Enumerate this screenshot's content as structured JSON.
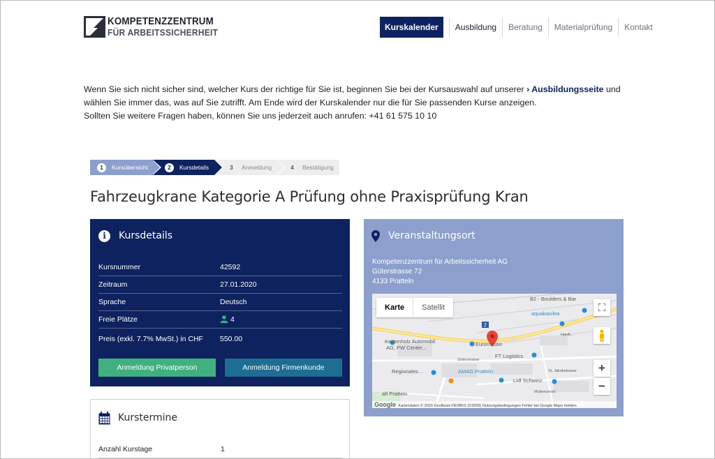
{
  "header": {
    "logo_line1": "KOMPETENZZENTRUM",
    "logo_line2": "FÜR ARBEITSSICHERHEIT",
    "nav": [
      {
        "label": "Kurskalender",
        "active": true
      },
      {
        "label": "Ausbildung"
      },
      {
        "label": "Beratung"
      },
      {
        "label": "Materialprüfung"
      },
      {
        "label": "Kontakt"
      }
    ]
  },
  "intro": {
    "part1": "Wenn Sie sich nicht sicher sind, welcher Kurs der richtige für Sie ist, beginnen Sie bei der Kursauswahl auf unserer",
    "link": "Ausbildungsseite",
    "part2": "und wählen Sie immer das, was auf Sie zutrifft. Am Ende wird der Kurskalender nur die für Sie passenden Kurse anzeigen.",
    "line3": "Sollten Sie weitere Fragen haben, können Sie uns jederzeit auch anrufen: +41 61 575 10 10"
  },
  "steps": [
    {
      "num": "1",
      "label": "Kursübersicht"
    },
    {
      "num": "2",
      "label": "Kursdetails"
    },
    {
      "num": "3",
      "label": "Anmeldung"
    },
    {
      "num": "4",
      "label": "Bestätigung"
    }
  ],
  "title": "Fahrzeugkrane Kategorie A Prüfung ohne Praxisprüfung Kran",
  "details": {
    "heading": "Kursdetails",
    "rows": [
      {
        "label": "Kursnummer",
        "value": "42592"
      },
      {
        "label": "Zeitraum",
        "value": "27.01.2020"
      },
      {
        "label": "Sprache",
        "value": "Deutsch"
      },
      {
        "label": "Freie Plätze",
        "value": "4"
      },
      {
        "label": "Preis (exkl. 7.7% MwSt.) in CHF",
        "value": "550.00"
      }
    ],
    "btn_private": "Anmeldung Privatperson",
    "btn_company": "Anmeldung Firmenkunde"
  },
  "venue": {
    "heading": "Veranstaltungsort",
    "address": [
      "Kompetenzzentrum für Arbeitssicherheit AG",
      "Güterstrasse 72",
      "4133 Pratteln"
    ],
    "map": {
      "toggle_map": "Karte",
      "toggle_sat": "Satellit",
      "labels": {
        "boulders": "B2 - Boulders & Bar",
        "aquabasilea": "aquabasilea",
        "kestenholz1": "Kestenholz Automobil",
        "kestenholz2": "AG, PW Center...",
        "euromaster": "Euromaster",
        "ft": "FT Logistics",
        "regionales": "Regionales...",
        "amag": "AMAG Pratteln",
        "lidl": "Lidl Schweiz",
        "gueter": "Güterstrasse",
        "mutten": "Muttenzerstr.",
        "jakob": "St. Jakobstrasse",
        "hardt": "Hardt...",
        "bpr": "aft Pratteln",
        "shield": "2"
      },
      "footer": "Kartendaten © 2020 GeoBasis-DE/BKG (©2009)    Nutzungsbedingungen    Fehler bei Google Maps melden",
      "google": "Google"
    }
  },
  "termine": {
    "heading": "Kurstermine",
    "rows": [
      {
        "label": "Anzahl Kurstage",
        "value": "1"
      }
    ]
  }
}
